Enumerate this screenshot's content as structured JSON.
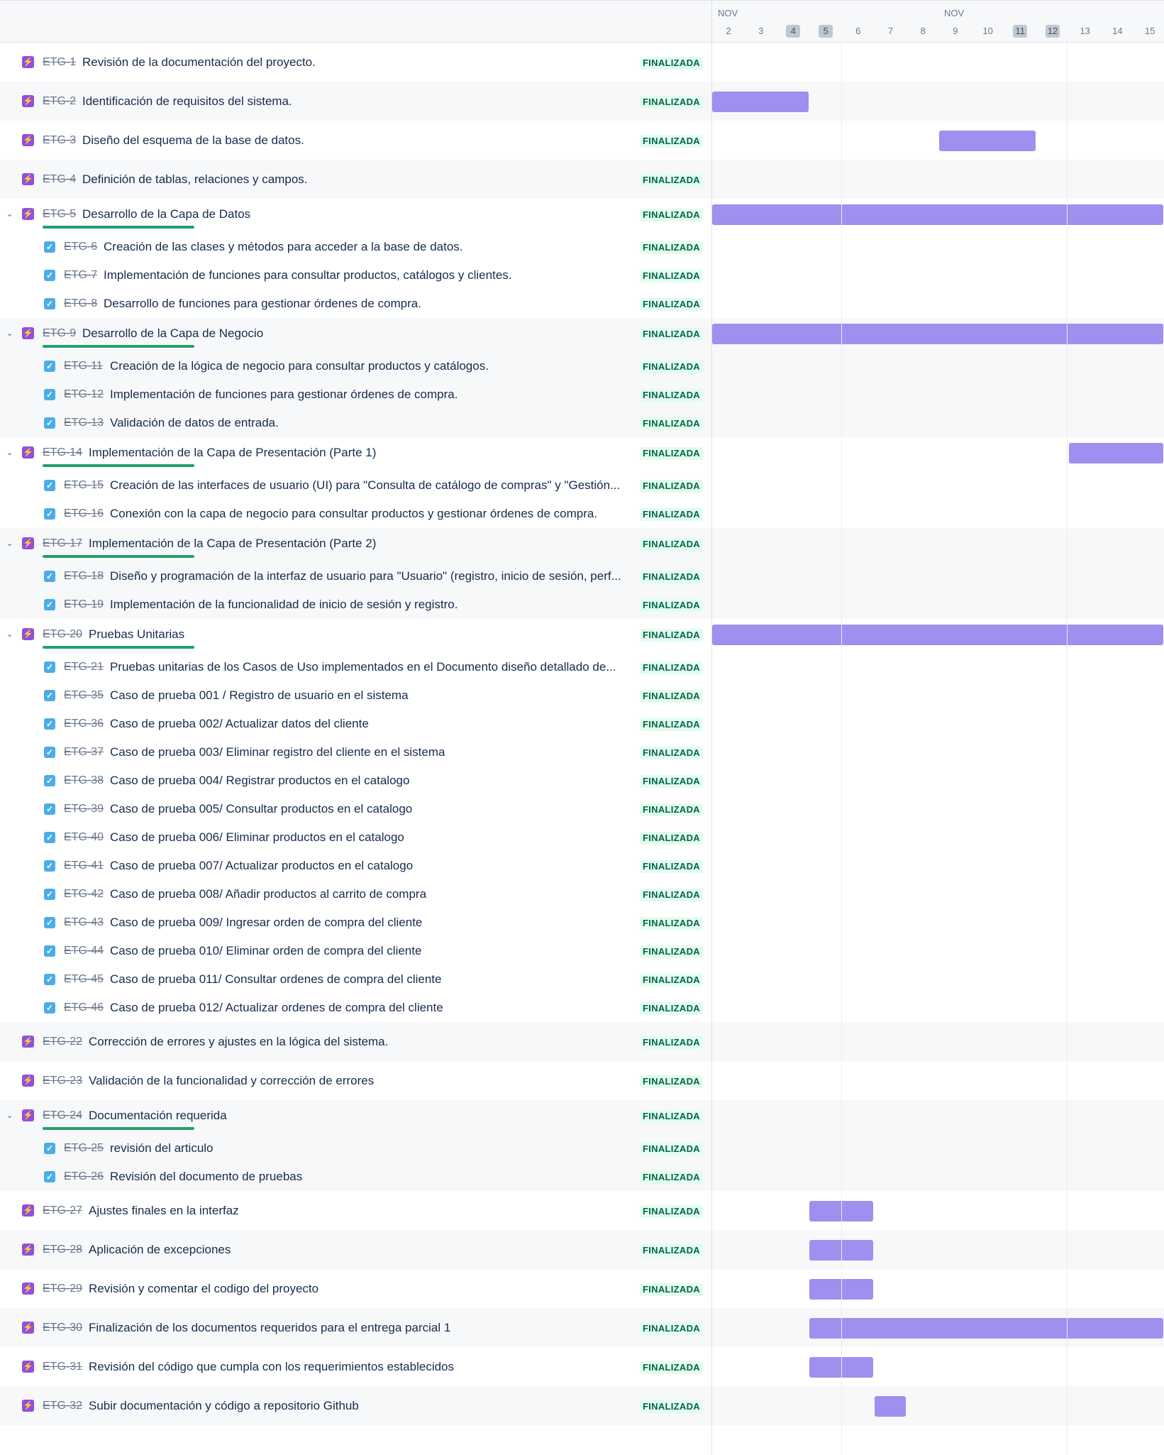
{
  "timeline": {
    "months": [
      "NOV",
      "NOV"
    ],
    "days": [
      {
        "label": "2",
        "weekend": false
      },
      {
        "label": "3",
        "weekend": false
      },
      {
        "label": "4",
        "weekend": true
      },
      {
        "label": "5",
        "weekend": true
      },
      {
        "label": "6",
        "weekend": false
      },
      {
        "label": "7",
        "weekend": false
      },
      {
        "label": "8",
        "weekend": false
      },
      {
        "label": "9",
        "weekend": false
      },
      {
        "label": "10",
        "weekend": false
      },
      {
        "label": "11",
        "weekend": true
      },
      {
        "label": "12",
        "weekend": true
      },
      {
        "label": "13",
        "weekend": false
      },
      {
        "label": "14",
        "weekend": false
      },
      {
        "label": "15",
        "weekend": false
      }
    ]
  },
  "status_label": "FINALIZADA",
  "colors": {
    "epic": "#904ee2",
    "task": "#4bade8",
    "bar": "#9f8fef",
    "status_bg": "#e3fcef",
    "status_fg": "#006644",
    "progress": "#22a06b"
  },
  "rows": [
    {
      "key": "ETG-1",
      "summary": "Revisión de la documentación del proyecto.",
      "type": "epic"
    },
    {
      "key": "ETG-2",
      "summary": "Identificación de requisitos del sistema.",
      "type": "epic",
      "bar": [
        2,
        5
      ]
    },
    {
      "key": "ETG-3",
      "summary": "Diseño del esquema de la base de datos.",
      "type": "epic",
      "bar": [
        9,
        12
      ]
    },
    {
      "key": "ETG-4",
      "summary": "Definición de tablas, relaciones y campos.",
      "type": "epic"
    },
    {
      "key": "ETG-5",
      "summary": "Desarrollo de la Capa de Datos",
      "type": "epic",
      "expanded": true,
      "progress": 1,
      "bar": [
        2,
        16
      ]
    },
    {
      "key": "ETG-6",
      "summary": "Creación de las clases y métodos para acceder a la base de datos.",
      "type": "task"
    },
    {
      "key": "ETG-7",
      "summary": "Implementación de funciones para consultar productos, catálogos y clientes.",
      "type": "task"
    },
    {
      "key": "ETG-8",
      "summary": "Desarrollo de funciones para gestionar órdenes de compra.",
      "type": "task"
    },
    {
      "key": "ETG-9",
      "summary": "Desarrollo de la Capa de Negocio",
      "type": "epic",
      "expanded": true,
      "progress": 1,
      "bar": [
        2,
        16
      ]
    },
    {
      "key": "ETG-11",
      "summary": "Creación de la lógica de negocio para consultar productos y catálogos.",
      "type": "task"
    },
    {
      "key": "ETG-12",
      "summary": "Implementación de funciones para gestionar órdenes de compra.",
      "type": "task"
    },
    {
      "key": "ETG-13",
      "summary": "Validación de datos de entrada.",
      "type": "task"
    },
    {
      "key": "ETG-14",
      "summary": "Implementación de la Capa de Presentación (Parte 1)",
      "type": "epic",
      "expanded": true,
      "progress": 1,
      "bar": [
        13,
        16
      ]
    },
    {
      "key": "ETG-15",
      "summary": "Creación de las interfaces de usuario (UI) para \"Consulta de catálogo de compras\" y \"Gestión...",
      "type": "task"
    },
    {
      "key": "ETG-16",
      "summary": "Conexión con la capa de negocio para consultar productos y gestionar órdenes de compra.",
      "type": "task"
    },
    {
      "key": "ETG-17",
      "summary": "Implementación de la Capa de Presentación (Parte 2)",
      "type": "epic",
      "expanded": true,
      "progress": 1
    },
    {
      "key": "ETG-18",
      "summary": "Diseño y programación de la interfaz de usuario para \"Usuario\" (registro, inicio de sesión, perf...",
      "type": "task"
    },
    {
      "key": "ETG-19",
      "summary": "Implementación de la funcionalidad de inicio de sesión y registro.",
      "type": "task"
    },
    {
      "key": "ETG-20",
      "summary": "Pruebas Unitarias",
      "type": "epic",
      "expanded": true,
      "progress": 1,
      "bar": [
        2,
        16
      ]
    },
    {
      "key": "ETG-21",
      "summary": "Pruebas unitarias de los Casos de Uso implementados en el Documento diseño detallado de...",
      "type": "task"
    },
    {
      "key": "ETG-35",
      "summary": "Caso de prueba 001 / Registro de usuario en el sistema",
      "type": "task"
    },
    {
      "key": "ETG-36",
      "summary": "Caso de prueba 002/ Actualizar datos del cliente",
      "type": "task"
    },
    {
      "key": "ETG-37",
      "summary": "Caso de prueba 003/ Eliminar registro del cliente en el sistema",
      "type": "task"
    },
    {
      "key": "ETG-38",
      "summary": "Caso de prueba 004/ Registrar productos en el catalogo",
      "type": "task"
    },
    {
      "key": "ETG-39",
      "summary": "Caso de prueba 005/ Consultar productos en el catalogo",
      "type": "task"
    },
    {
      "key": "ETG-40",
      "summary": "Caso de prueba 006/ Eliminar productos en el catalogo",
      "type": "task"
    },
    {
      "key": "ETG-41",
      "summary": "Caso de prueba 007/ Actualizar productos en el catalogo",
      "type": "task"
    },
    {
      "key": "ETG-42",
      "summary": "Caso de prueba 008/ Añadir productos al carrito de compra",
      "type": "task"
    },
    {
      "key": "ETG-43",
      "summary": "Caso de prueba 009/ Ingresar orden de compra del cliente",
      "type": "task"
    },
    {
      "key": "ETG-44",
      "summary": "Caso de prueba 010/ Eliminar orden de compra del cliente",
      "type": "task"
    },
    {
      "key": "ETG-45",
      "summary": "Caso de prueba 011/ Consultar ordenes de compra del cliente",
      "type": "task"
    },
    {
      "key": "ETG-46",
      "summary": "Caso de prueba 012/ Actualizar ordenes de compra del cliente",
      "type": "task"
    },
    {
      "key": "ETG-22",
      "summary": "Corrección de errores y ajustes en la lógica del sistema.",
      "type": "epic"
    },
    {
      "key": "ETG-23",
      "summary": "Validación de la funcionalidad y corrección de errores",
      "type": "epic"
    },
    {
      "key": "ETG-24",
      "summary": "Documentación requerida",
      "type": "epic",
      "expanded": true,
      "progress": 1
    },
    {
      "key": "ETG-25",
      "summary": "revisión del articulo",
      "type": "task"
    },
    {
      "key": "ETG-26",
      "summary": "Revisión del documento de pruebas",
      "type": "task"
    },
    {
      "key": "ETG-27",
      "summary": "Ajustes finales en la interfaz",
      "type": "epic",
      "bar": [
        5,
        7
      ]
    },
    {
      "key": "ETG-28",
      "summary": "Aplicación de excepciones",
      "type": "epic",
      "bar": [
        5,
        7
      ]
    },
    {
      "key": "ETG-29",
      "summary": "Revisión y comentar el codigo del proyecto",
      "type": "epic",
      "bar": [
        5,
        7
      ]
    },
    {
      "key": "ETG-30",
      "summary": "Finalización de los documentos requeridos para el entrega parcial 1",
      "type": "epic",
      "bar": [
        5,
        16
      ]
    },
    {
      "key": "ETG-31",
      "summary": "Revisión del código que cumpla con los requerimientos establecidos",
      "type": "epic",
      "bar": [
        5,
        7
      ]
    },
    {
      "key": "ETG-32",
      "summary": "Subir documentación y código a repositorio Github",
      "type": "epic",
      "bar": [
        7,
        8
      ]
    }
  ]
}
